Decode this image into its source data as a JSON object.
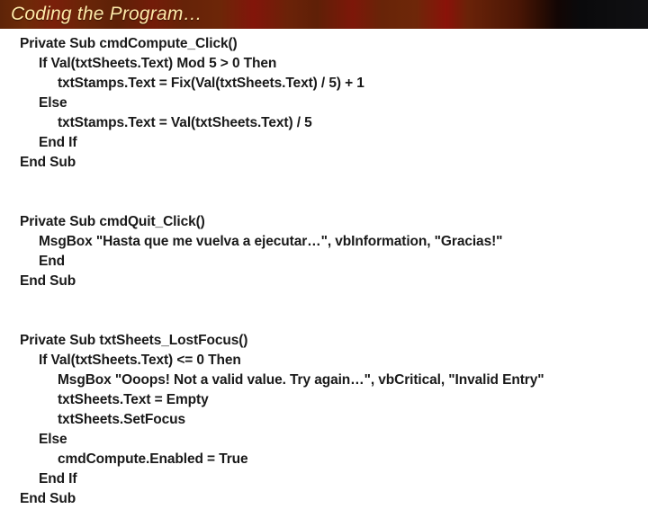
{
  "slide": {
    "title": "Coding the Program…",
    "title_color": "#ffe9a8",
    "title_bar_color_left": "#5e2408",
    "title_bar_color_right": "#101013",
    "body_background": "#ffffff",
    "code_text_color": "#191919"
  },
  "code": {
    "language": "Visual Basic",
    "lines": [
      {
        "indent": 0,
        "text": "Private Sub cmdCompute_Click()"
      },
      {
        "indent": 1,
        "text": "If Val(txtSheets.Text) Mod 5 > 0 Then"
      },
      {
        "indent": 2,
        "text": "txtStamps.Text = Fix(Val(txtSheets.Text) / 5) + 1"
      },
      {
        "indent": 1,
        "text": "Else"
      },
      {
        "indent": 2,
        "text": "txtStamps.Text = Val(txtSheets.Text) / 5"
      },
      {
        "indent": 1,
        "text": "End If"
      },
      {
        "indent": 0,
        "text": "End Sub"
      },
      {
        "indent": 0,
        "text": ""
      },
      {
        "indent": 0,
        "text": ""
      },
      {
        "indent": 0,
        "text": "Private Sub cmdQuit_Click()"
      },
      {
        "indent": 1,
        "text": "MsgBox \"Hasta que me vuelva a ejecutar…\", vbInformation, \"Gracias!\""
      },
      {
        "indent": 1,
        "text": "End"
      },
      {
        "indent": 0,
        "text": "End Sub"
      },
      {
        "indent": 0,
        "text": ""
      },
      {
        "indent": 0,
        "text": ""
      },
      {
        "indent": 0,
        "text": "Private Sub txtSheets_LostFocus()"
      },
      {
        "indent": 1,
        "text": "If Val(txtSheets.Text) <= 0 Then"
      },
      {
        "indent": 2,
        "text": "MsgBox \"Ooops! Not a valid value. Try again…\", vbCritical, \"Invalid Entry\""
      },
      {
        "indent": 2,
        "text": "txtSheets.Text = Empty"
      },
      {
        "indent": 2,
        "text": "txtSheets.SetFocus"
      },
      {
        "indent": 1,
        "text": "Else"
      },
      {
        "indent": 2,
        "text": "cmdCompute.Enabled = True"
      },
      {
        "indent": 1,
        "text": "End If"
      },
      {
        "indent": 0,
        "text": "End Sub"
      }
    ]
  }
}
